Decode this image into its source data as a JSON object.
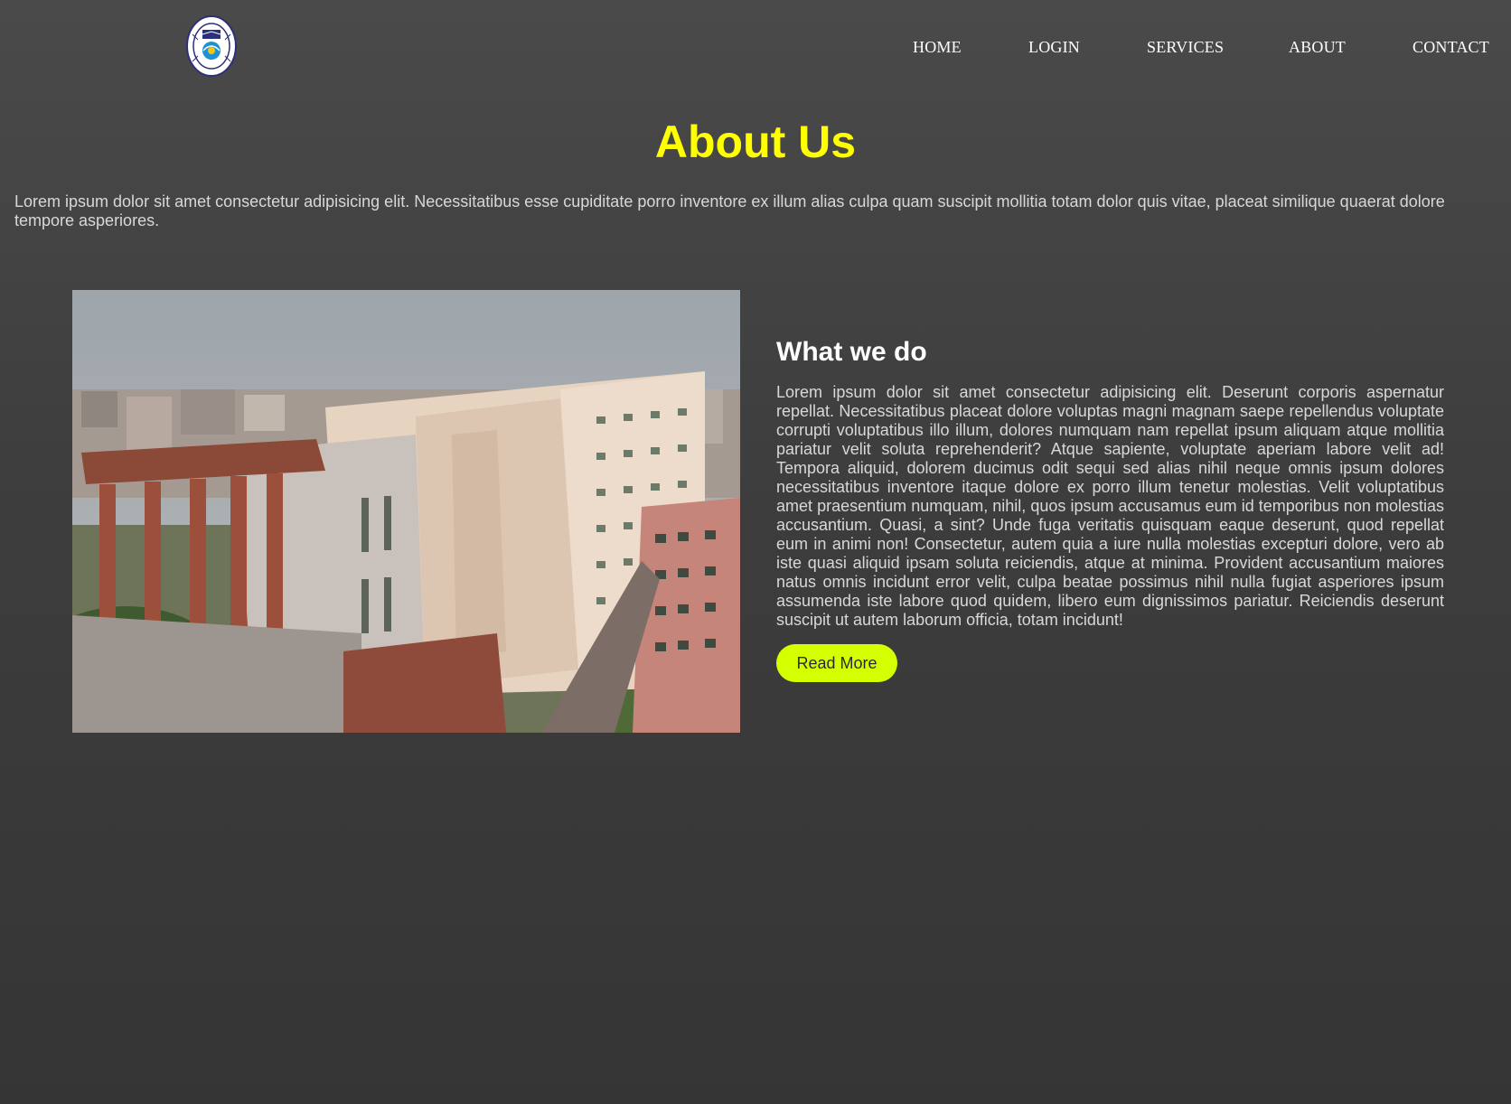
{
  "header": {
    "logo_icon": "university-seal-logo",
    "nav": [
      {
        "label": "HOME"
      },
      {
        "label": "LOGIN"
      },
      {
        "label": "SERVICES"
      },
      {
        "label": "ABOUT"
      },
      {
        "label": "CONTACT"
      }
    ]
  },
  "about": {
    "title": "About Us",
    "intro": "Lorem ipsum dolor sit amet consectetur adipisicing elit. Necessitatibus esse cupiditate porro inventore ex illum alias culpa quam suscipit mollitia totam dolor quis vitae, placeat similique quaerat dolore tempore asperiores."
  },
  "what_we_do": {
    "image_subject": "campus-building-photo",
    "title": "What we do",
    "body": "Lorem ipsum dolor sit amet consectetur adipisicing elit. Deserunt corporis aspernatur repellat. Necessitatibus placeat dolore voluptas magni magnam saepe repellendus voluptate corrupti voluptatibus illo illum, dolores numquam nam repellat ipsum aliquam atque mollitia pariatur velit soluta reprehenderit? Atque sapiente, voluptate aperiam labore velit ad! Tempora aliquid, dolorem ducimus odit sequi sed alias nihil neque omnis ipsum dolores necessitatibus inventore itaque dolore ex porro illum tenetur molestias. Velit voluptatibus amet praesentium numquam, nihil, quos ipsum accusamus eum id temporibus non molestias accusantium. Quasi, a sint? Unde fuga veritatis quisquam eaque deserunt, quod repellat eum in animi non! Consectetur, autem quia a iure nulla molestias excepturi dolore, vero ab iste quasi aliquid ipsam soluta reiciendis, atque at minima. Provident accusantium maiores natus omnis incidunt error velit, culpa beatae possimus nihil nulla fugiat asperiores ipsum assumenda iste labore quod quidem, libero eum dignissimos pariatur. Reiciendis deserunt suscipit ut autem laborum officia, totam incidunt!",
    "button_label": "Read More"
  },
  "colors": {
    "title": "#ffff00",
    "button": "#d4ff00",
    "background": "#404040"
  }
}
